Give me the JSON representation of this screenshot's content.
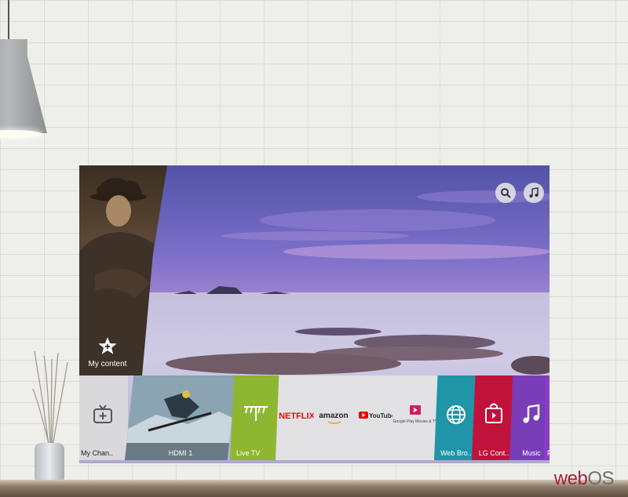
{
  "brand": {
    "web": "web",
    "os": "OS",
    "web_color": "#a3223e"
  },
  "screen": {
    "search_icon": "search-icon",
    "music_icon": "music-note-icon",
    "my_content_label": "My content"
  },
  "launcher": {
    "tiles": [
      {
        "label": "My Chan..",
        "icon": "channel-add-icon",
        "color": "#d9d9dc"
      },
      {
        "label": "HDMI 1",
        "icon": "hdmi-preview",
        "color": "#6f8a98"
      },
      {
        "label": "Live TV",
        "icon": "antenna-icon",
        "color": "#8fb630"
      },
      {
        "label": "NETFLIX",
        "icon": "netflix-logo",
        "color": "#e2e2e4"
      },
      {
        "label": "amazon",
        "icon": "amazon-logo",
        "color": "#e2e2e4"
      },
      {
        "label": "YouTube",
        "icon": "youtube-logo",
        "color": "#e2e2e4"
      },
      {
        "label": "Google Play Movies & TV",
        "icon": "google-play-movies-logo",
        "color": "#e2e2e4"
      },
      {
        "label": "Web Bro..",
        "icon": "globe-icon",
        "color": "#1f95a7"
      },
      {
        "label": "LG Cont..",
        "icon": "store-bag-icon",
        "color": "#c1123b"
      },
      {
        "label": "Music",
        "icon": "music-note-icon",
        "color": "#7a3db8"
      },
      {
        "label": "P",
        "icon": "partial-tile",
        "color": "#8a3cc4"
      }
    ]
  }
}
